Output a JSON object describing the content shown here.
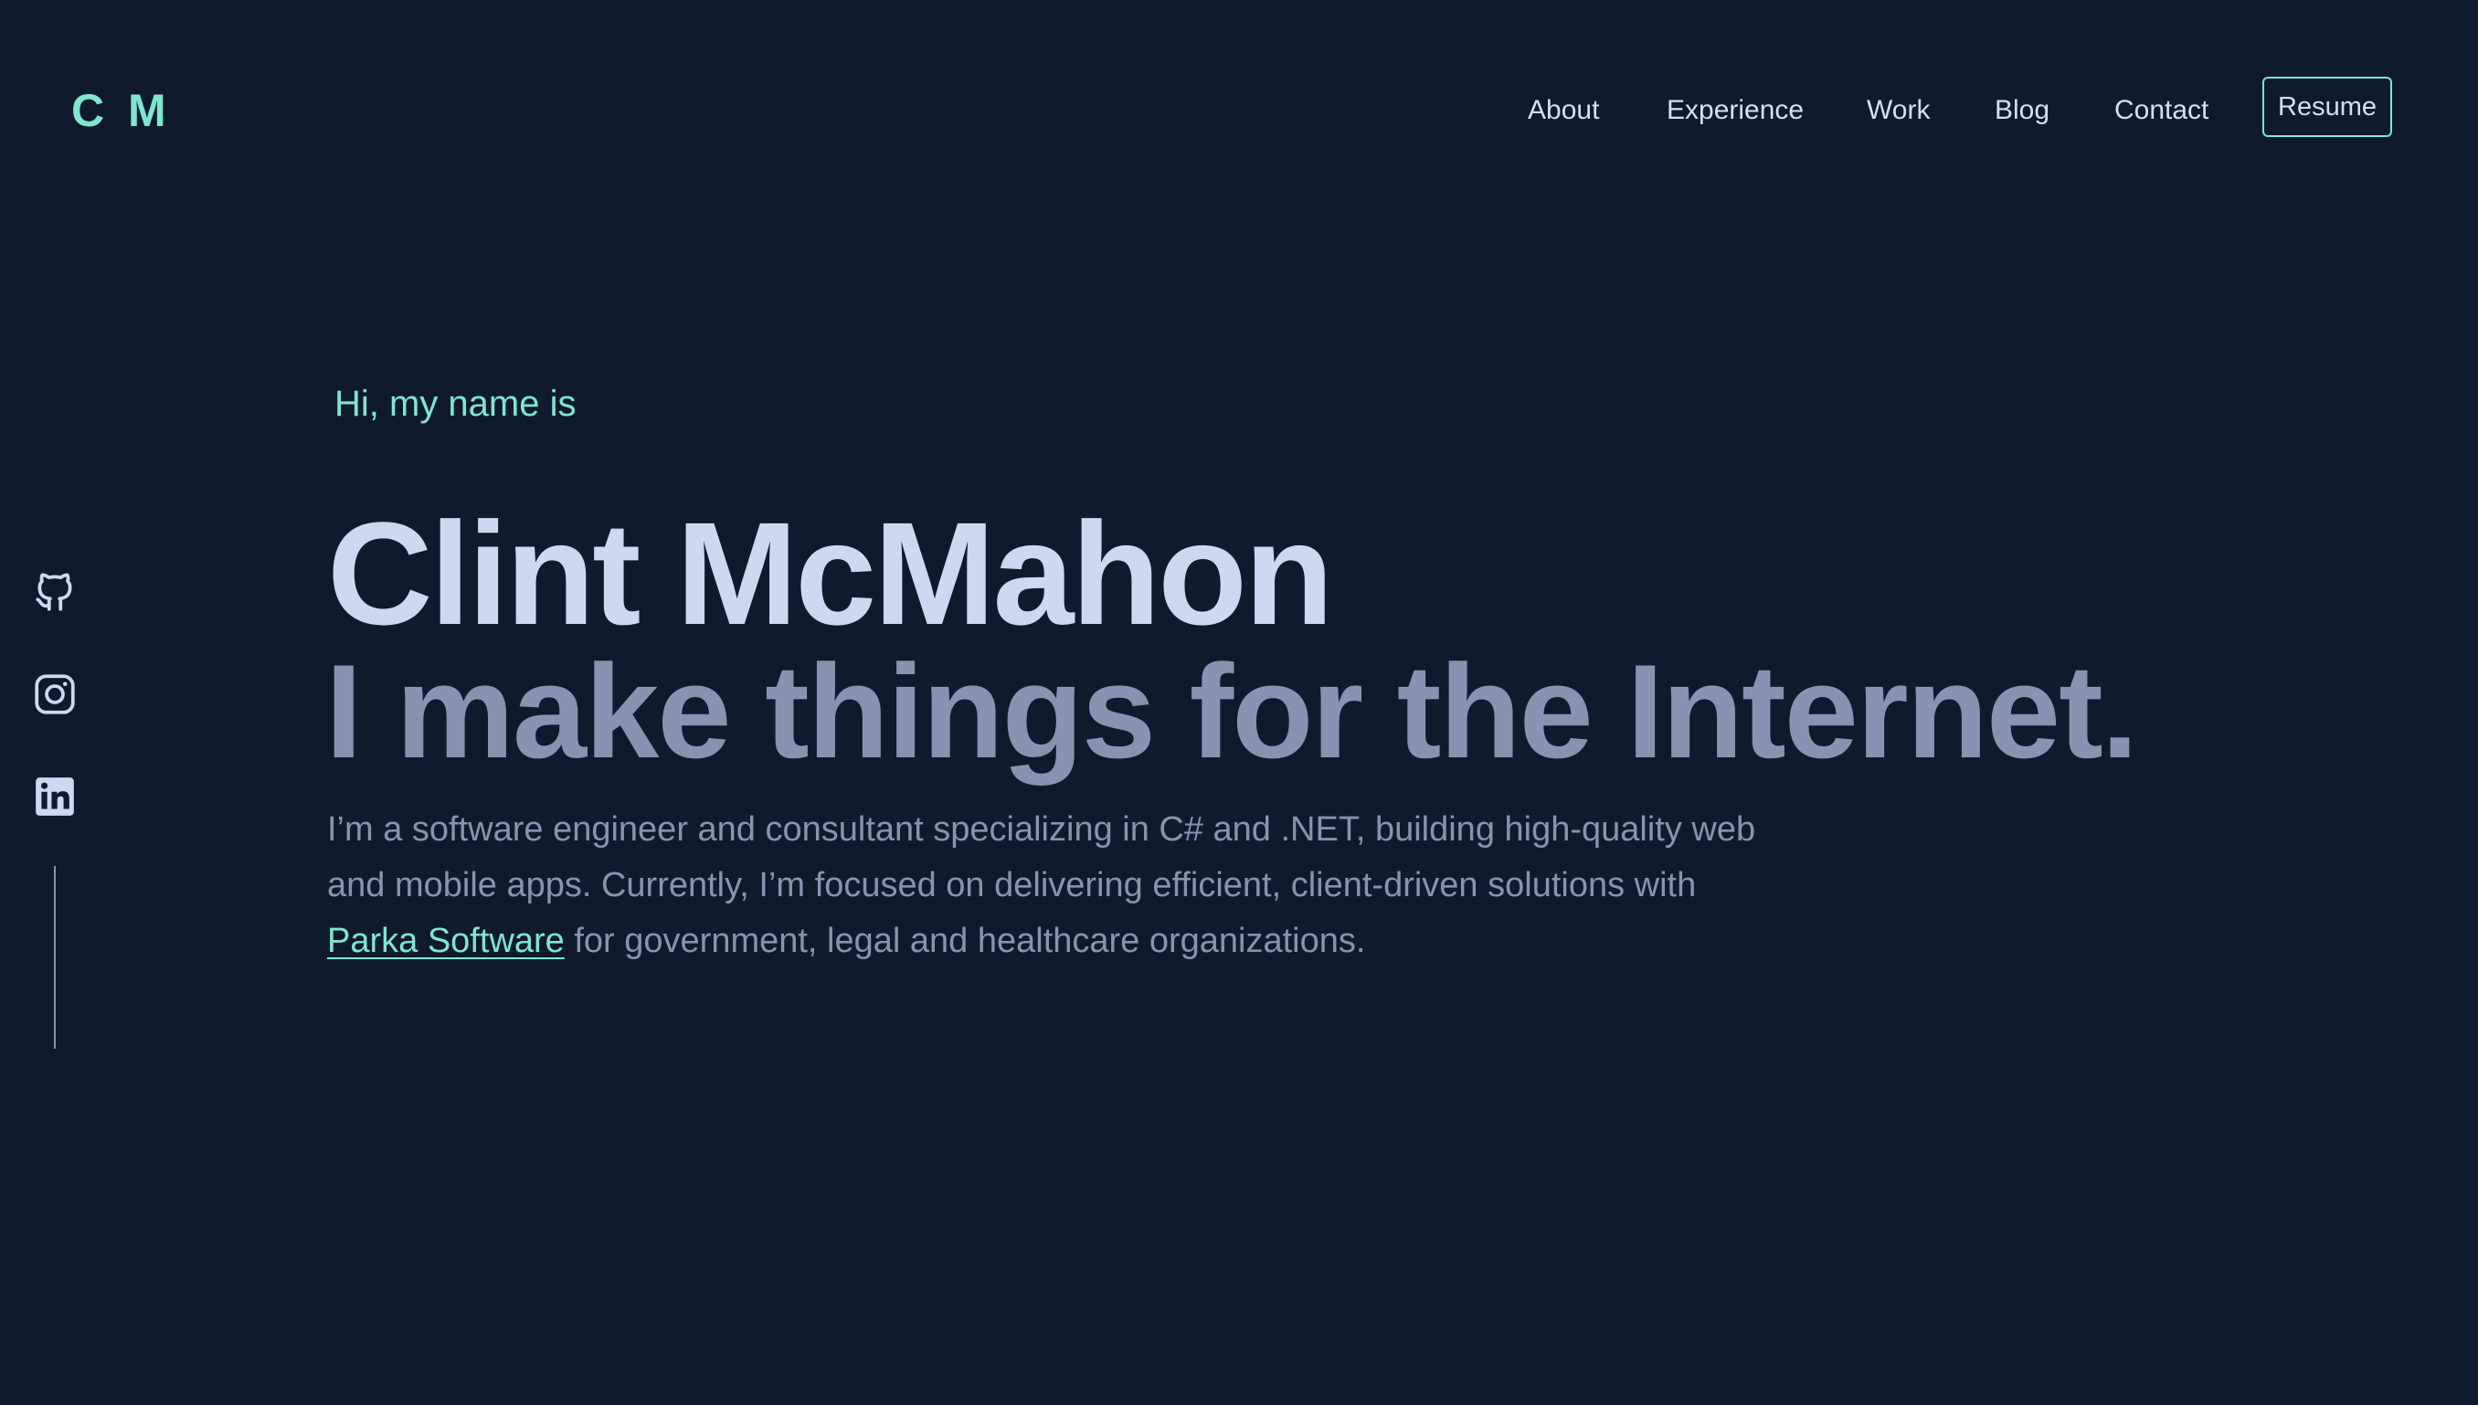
{
  "header": {
    "logo": "C M",
    "nav": [
      {
        "label": "About"
      },
      {
        "label": "Experience"
      },
      {
        "label": "Work"
      },
      {
        "label": "Blog"
      },
      {
        "label": "Contact"
      }
    ],
    "resume_label": "Resume"
  },
  "hero": {
    "greeting": "Hi, my name is",
    "name": "Clint McMahon",
    "tagline": "I make things for the Internet.",
    "bio_before": "I’m a software engineer and consultant specializing in C# and .NET, building high-quality web and mobile apps. Currently, I’m focused on delivering efficient, client-driven solutions with ",
    "bio_link": "Parka Software",
    "bio_after": " for government, legal and healthcare organizations."
  },
  "social": [
    {
      "icon": "github-icon"
    },
    {
      "icon": "instagram-icon"
    },
    {
      "icon": "linkedin-icon"
    }
  ],
  "colors": {
    "background": "#0f1a2e",
    "accent": "#7fe6d0",
    "heading": "#cfd7f2",
    "muted": "#8992b0"
  }
}
